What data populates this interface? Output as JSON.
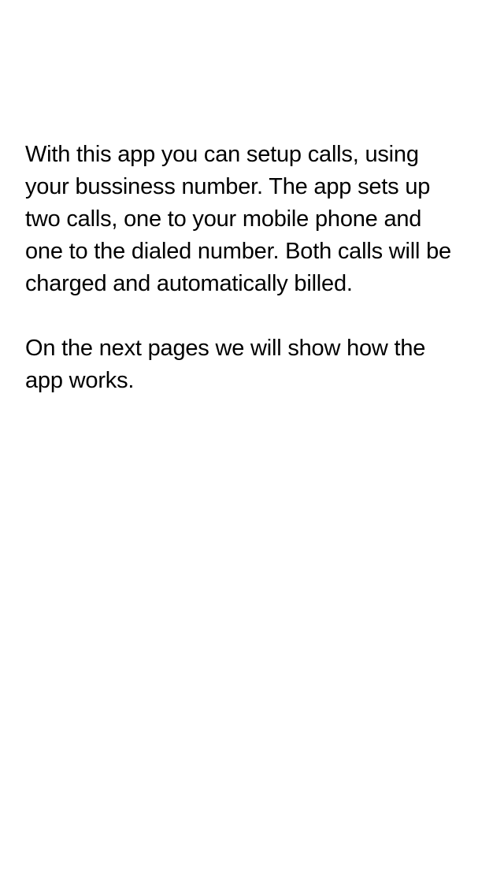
{
  "intro": {
    "paragraph1": [
      "With this app you can setup calls, using",
      "your bussiness number. The app sets up",
      "two calls, one to your mobile phone and",
      "one to the dialed number. Both calls will be",
      "charged and automatically billed."
    ],
    "paragraph2": [
      "On the next pages we will show how the",
      "app works."
    ]
  }
}
